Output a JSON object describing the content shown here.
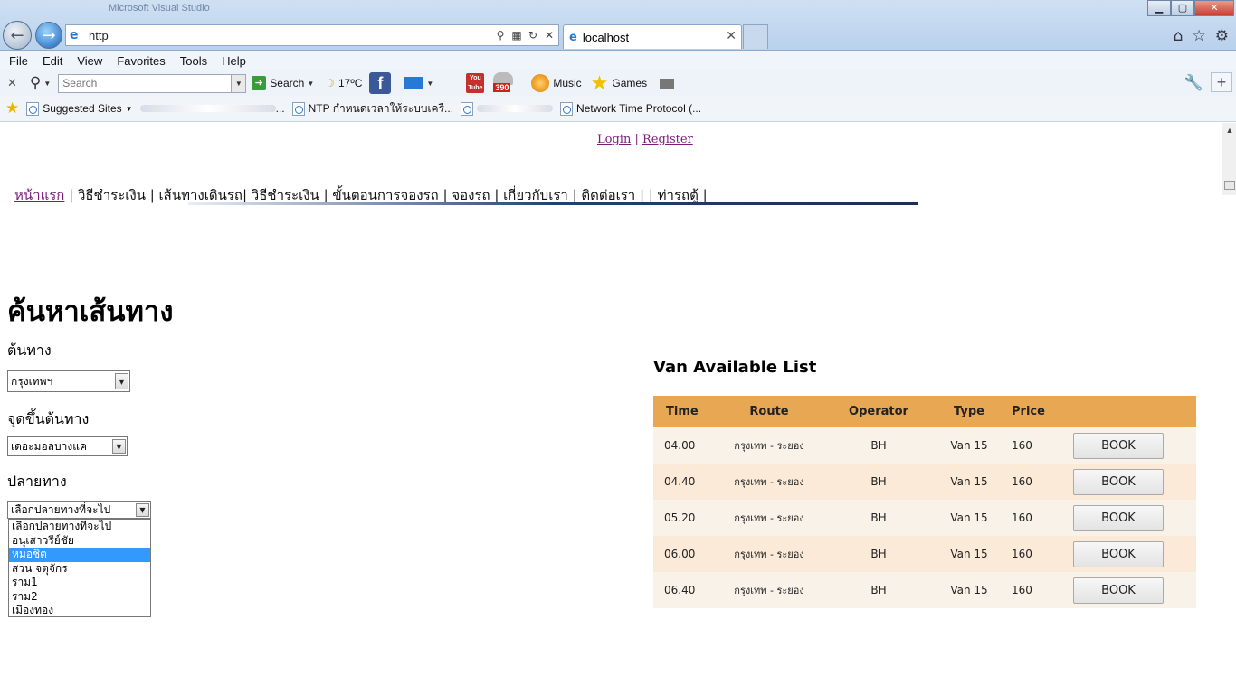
{
  "browser": {
    "ghost_title": "Microsoft Visual Studio",
    "address_url": "http",
    "tab_title": "localhost",
    "menu": [
      "File",
      "Edit",
      "View",
      "Favorites",
      "Tools",
      "Help"
    ],
    "search_placeholder": "Search",
    "search_label": "Search",
    "weather": "17ºC",
    "music": "Music",
    "games": "Games",
    "badge_count": "390",
    "favorites": {
      "suggested": "Suggested Sites",
      "ellipsis": "...",
      "ntp": "NTP กำหนดเวลาให้ระบบเครื...",
      "network_time": "Network Time Protocol (..."
    }
  },
  "auth": {
    "login": "Login",
    "sep": "|",
    "register": "Register"
  },
  "nav": {
    "home": "หน้าแรก",
    "rest": " | วิธีชำระเงิน | เส้นทางเดินรถ| วิธีชำระเงิน | ขั้นตอนการจองรถ | จองรถ | เกี่ยวกับเรา | ติดต่อเรา |  | ท่ารถตู้ |"
  },
  "search_form": {
    "title": "ค้นหาเส้นทาง",
    "origin_label": "ต้นทาง",
    "origin_value": "กรุงเทพฯ",
    "pickup_label": "จุดขึ้นต้นทาง",
    "pickup_value": "เดอะมอลบางแค",
    "dest_label": "ปลายทาง",
    "dest_value": "เลือกปลายทางที่จะไป",
    "dest_options": [
      "เลือกปลายทางที่จะไป",
      "อนุเสาวรีย์ชัย",
      "หมอชิต",
      "สวน จตุจักร",
      "ราม1",
      "ราม2",
      "เมืองทอง"
    ],
    "dest_highlighted_index": 2
  },
  "van_list": {
    "title": "Van Available List",
    "headers": [
      "Time",
      "Route",
      "Operator",
      "Type",
      "Price"
    ],
    "rows": [
      {
        "time": "04.00",
        "route": "กรุงเทพ - ระยอง",
        "operator": "BH",
        "type": "Van 15",
        "price": "160",
        "action": "BOOK"
      },
      {
        "time": "04.40",
        "route": "กรุงเทพ - ระยอง",
        "operator": "BH",
        "type": "Van 15",
        "price": "160",
        "action": "BOOK"
      },
      {
        "time": "05.20",
        "route": "กรุงเทพ - ระยอง",
        "operator": "BH",
        "type": "Van 15",
        "price": "160",
        "action": "BOOK"
      },
      {
        "time": "06.00",
        "route": "กรุงเทพ - ระยอง",
        "operator": "BH",
        "type": "Van 15",
        "price": "160",
        "action": "BOOK"
      },
      {
        "time": "06.40",
        "route": "กรุงเทพ - ระยอง",
        "operator": "BH",
        "type": "Van 15",
        "price": "160",
        "action": "BOOK"
      }
    ]
  },
  "colors": {
    "header_bg": "#e8a752",
    "row_odd": "#f8f2e9",
    "row_even": "#fbead7",
    "link": "#7a1b7a",
    "highlight": "#3399ff"
  }
}
